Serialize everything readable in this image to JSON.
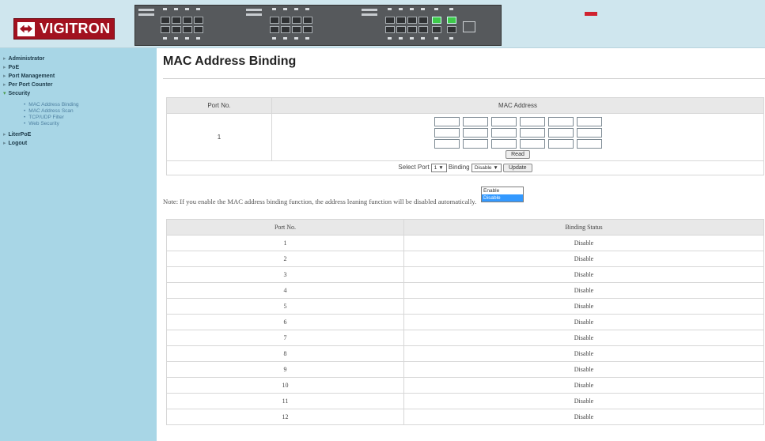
{
  "header": {
    "brand": "VIGITRON"
  },
  "sidebar": {
    "items": [
      {
        "label": "Administrator"
      },
      {
        "label": "PoE"
      },
      {
        "label": "Port Management"
      },
      {
        "label": "Per Port Counter"
      },
      {
        "label": "Security",
        "subitems": [
          {
            "label": "MAC Address Binding"
          },
          {
            "label": "MAC Address Scan"
          },
          {
            "label": "TCP/UDP Filter"
          },
          {
            "label": "Web Security"
          }
        ]
      },
      {
        "label": "LiterPoE"
      },
      {
        "label": "Logout"
      }
    ]
  },
  "page": {
    "title": "MAC Address Binding"
  },
  "mac_table": {
    "col_port": "Port No.",
    "col_mac": "MAC Address",
    "port_value": "1",
    "read_label": "Read"
  },
  "controls": {
    "select_port_label": "Select Port",
    "port_selected": "1",
    "binding_label": "Binding",
    "binding_selected": "Disable",
    "binding_options": [
      "Enable",
      "Disable"
    ],
    "update_label": "Update"
  },
  "note_text": "Note: If you enable the MAC address binding function, the address leaning function will be disabled automatically.",
  "status_table": {
    "col_port": "Port No.",
    "col_status": "Binding Status",
    "rows": [
      {
        "port": "1",
        "status": "Disable"
      },
      {
        "port": "2",
        "status": "Disable"
      },
      {
        "port": "3",
        "status": "Disable"
      },
      {
        "port": "4",
        "status": "Disable"
      },
      {
        "port": "5",
        "status": "Disable"
      },
      {
        "port": "6",
        "status": "Disable"
      },
      {
        "port": "7",
        "status": "Disable"
      },
      {
        "port": "8",
        "status": "Disable"
      },
      {
        "port": "9",
        "status": "Disable"
      },
      {
        "port": "10",
        "status": "Disable"
      },
      {
        "port": "11",
        "status": "Disable"
      },
      {
        "port": "12",
        "status": "Disable"
      }
    ]
  },
  "colors": {
    "sidebar_bg": "#a8d6e6",
    "header_bg": "#cfe6ee",
    "brand_red": "#a2111f",
    "dropdown_highlight": "#3399ff"
  }
}
